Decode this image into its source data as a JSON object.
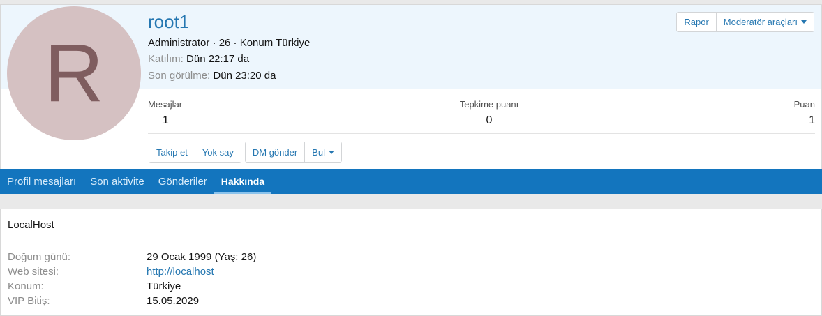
{
  "profile": {
    "avatar_letter": "R",
    "username": "root1",
    "role_line": "Administrator · 26 · Konum Türkiye",
    "joined_label": "Katılım:",
    "joined_value": "Dün 22:17 da",
    "last_seen_label": "Son görülme:",
    "last_seen_value": "Dün 23:20 da"
  },
  "top_actions": {
    "report": "Rapor",
    "moderator_tools": "Moderatör araçları"
  },
  "stats": [
    {
      "label": "Mesajlar",
      "value": "1"
    },
    {
      "label": "Tepkime puanı",
      "value": "0"
    },
    {
      "label": "Puan",
      "value": "1"
    }
  ],
  "profile_actions": {
    "follow": "Takip et",
    "ignore": "Yok say",
    "dm": "DM gönder",
    "find": "Bul"
  },
  "tabs": [
    {
      "label": "Profil mesajları"
    },
    {
      "label": "Son aktivite"
    },
    {
      "label": "Gönderiler"
    },
    {
      "label": "Hakkında"
    }
  ],
  "about": {
    "title": "LocalHost",
    "birthday_label": "Doğum günü:",
    "birthday_value": "29 Ocak 1999 (Yaş: 26)",
    "website_label": "Web sitesi:",
    "website_value": "http://localhost",
    "location_label": "Konum:",
    "location_value": "Türkiye",
    "vip_label": "VIP Bitiş:",
    "vip_value": "15.05.2029"
  },
  "colors": {
    "accent": "#2577b1",
    "nav_bg": "#1375be",
    "header_bg": "#edf6fd",
    "avatar_bg": "#d5c1c2"
  }
}
